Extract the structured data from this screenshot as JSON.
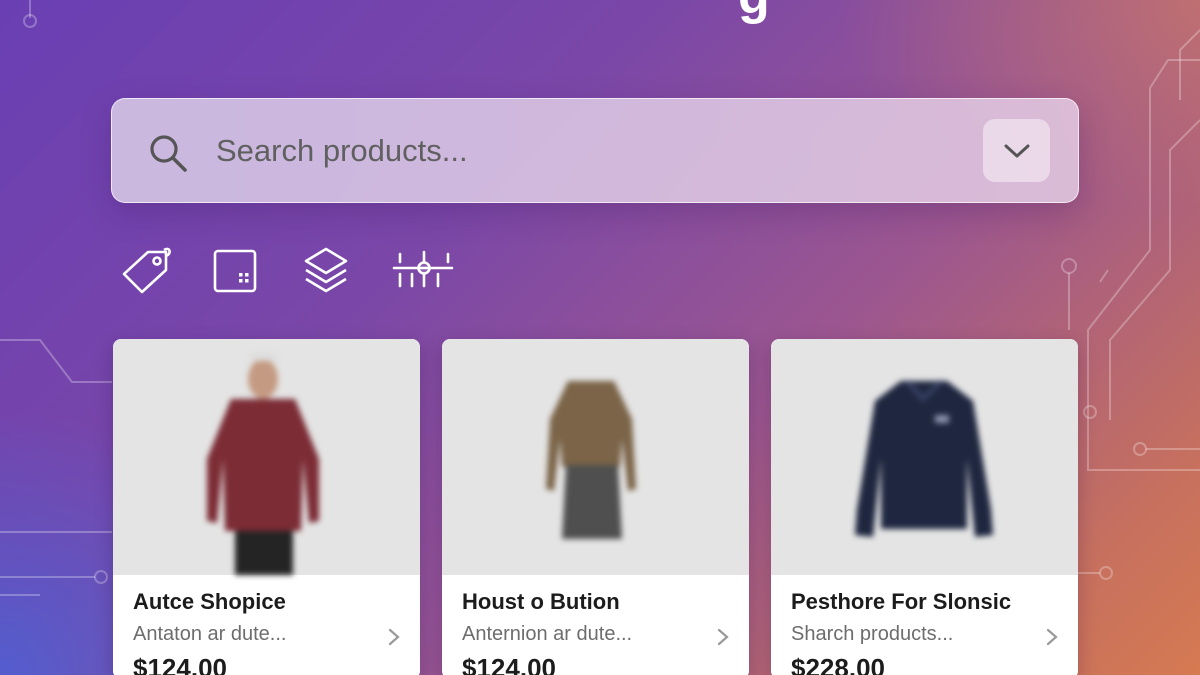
{
  "header": {
    "title_fragment": "g"
  },
  "search": {
    "placeholder": "Search products...",
    "icon": "search-icon",
    "dropdown_icon": "chevron-down-icon"
  },
  "filters": [
    {
      "icon": "tag-icon"
    },
    {
      "icon": "grid-icon"
    },
    {
      "icon": "layers-icon"
    },
    {
      "icon": "sliders-icon"
    }
  ],
  "products": [
    {
      "title": "Autce Shopice",
      "subtitle": "Antaton ar dute...",
      "price": "$124.00",
      "image": "maroon-sweater"
    },
    {
      "title": "Houst o Bution",
      "subtitle": "Anternion ar dute...",
      "price": "$124.00",
      "image": "brown-sweater-skirt"
    },
    {
      "title": "Pesthore For Slonsic",
      "subtitle": "Sharch products...",
      "price": "$228.00",
      "image": "navy-jacket"
    }
  ],
  "colors": {
    "gradient_start": "#6a3fb3",
    "gradient_end": "#d67a52",
    "card_bg": "#ffffff",
    "image_bg": "#e4e4e4"
  }
}
